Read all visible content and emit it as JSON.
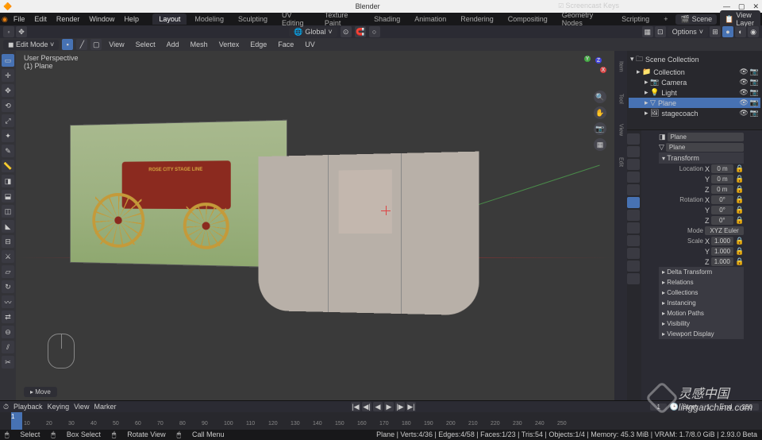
{
  "app": {
    "title": "Blender"
  },
  "menu": {
    "items": [
      "File",
      "Edit",
      "Render",
      "Window",
      "Help"
    ]
  },
  "workspace_tabs": [
    "Layout",
    "Modeling",
    "Sculpting",
    "UV Editing",
    "Texture Paint",
    "Shading",
    "Animation",
    "Rendering",
    "Compositing",
    "Geometry Nodes",
    "Scripting"
  ],
  "active_workspace": "Layout",
  "header_right": {
    "scene": "Scene",
    "view_layer": "View Layer"
  },
  "toolbar2": {
    "orientation": "Global",
    "options": "Options"
  },
  "edit_header": {
    "mode": "Edit Mode",
    "menus": [
      "View",
      "Select",
      "Add",
      "Mesh",
      "Vertex",
      "Edge",
      "Face",
      "UV"
    ]
  },
  "viewport": {
    "perspective": "User Perspective",
    "object": "(1) Plane",
    "screencast": "Screencast Keys",
    "move_hint": "▸ Move"
  },
  "outliner": {
    "title": "Scene Collection",
    "items": [
      {
        "label": "Collection",
        "indent": 1,
        "sel": false,
        "icon": "📁"
      },
      {
        "label": "Camera",
        "indent": 2,
        "sel": false,
        "icon": "📷"
      },
      {
        "label": "Light",
        "indent": 2,
        "sel": false,
        "icon": "💡"
      },
      {
        "label": "Plane",
        "indent": 2,
        "sel": true,
        "icon": "▽"
      },
      {
        "label": "stagecoach",
        "indent": 2,
        "sel": false,
        "icon": "🖼"
      }
    ]
  },
  "properties": {
    "object_name": "Plane",
    "data_name": "Plane",
    "transform_label": "Transform",
    "location": {
      "label": "Location",
      "x": "0 m",
      "y": "0 m",
      "z": "0 m"
    },
    "rotation": {
      "label": "Rotation",
      "x": "0°",
      "y": "0°",
      "z": "0°"
    },
    "mode": {
      "label": "Mode",
      "value": "XYZ Euler"
    },
    "scale": {
      "label": "Scale",
      "x": "1.000",
      "y": "1.000",
      "z": "1.000"
    },
    "sections": [
      "Delta Transform",
      "Relations",
      "Collections",
      "Instancing",
      "Motion Paths",
      "Visibility",
      "Viewport Display"
    ]
  },
  "timeline": {
    "menus": [
      "Playback",
      "Keying",
      "View",
      "Marker"
    ],
    "current": "1",
    "start_label": "Start",
    "start": "1",
    "end_label": "End",
    "end": "250",
    "ticks": [
      "10",
      "20",
      "30",
      "40",
      "50",
      "60",
      "70",
      "80",
      "90",
      "100",
      "110",
      "120",
      "130",
      "140",
      "150",
      "160",
      "170",
      "180",
      "190",
      "200",
      "210",
      "220",
      "230",
      "240",
      "250"
    ]
  },
  "statusbar": {
    "items": [
      "Select",
      "Box Select",
      "Rotate View",
      "Call Menu"
    ],
    "stats": "Plane | Verts:4/36 | Edges:4/58 | Faces:1/23 | Tris:54 | Objects:1/4 | Memory: 45.3 MiB | VRAM: 1.7/8.0 GiB | 2.93.0 Beta"
  },
  "reference": {
    "banner": "ROSE CITY STAGE LINE"
  },
  "watermark": {
    "cn": "灵感中国",
    "url": "lingganchina.com"
  }
}
